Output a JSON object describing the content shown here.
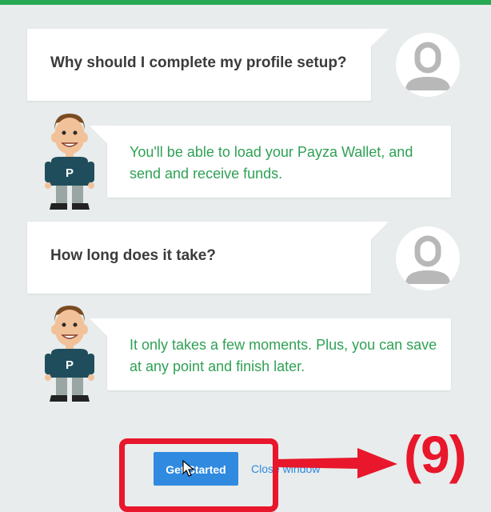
{
  "colors": {
    "accent_green": "#27a954",
    "answer_text": "#2fa155",
    "button_blue": "#2f8ae0",
    "annotation_red": "#e8172b"
  },
  "conversation": [
    {
      "role": "user",
      "text": "Why should I complete my profile setup?",
      "icon": "user-avatar-icon"
    },
    {
      "role": "assistant",
      "text": "You'll be able to load your Payza Wallet, and send and receive funds.",
      "icon": "payza-mascot-icon"
    },
    {
      "role": "user",
      "text": "How long does it take?",
      "icon": "user-avatar-icon"
    },
    {
      "role": "assistant",
      "text": "It only takes a few moments. Plus, you can save at any point and finish later.",
      "icon": "payza-mascot-icon"
    }
  ],
  "mascot": {
    "shirt_letter": "P"
  },
  "actions": {
    "get_started_label": "Get Started",
    "close_window_label": "Close window"
  },
  "annotation": {
    "step_label": "(9)"
  }
}
